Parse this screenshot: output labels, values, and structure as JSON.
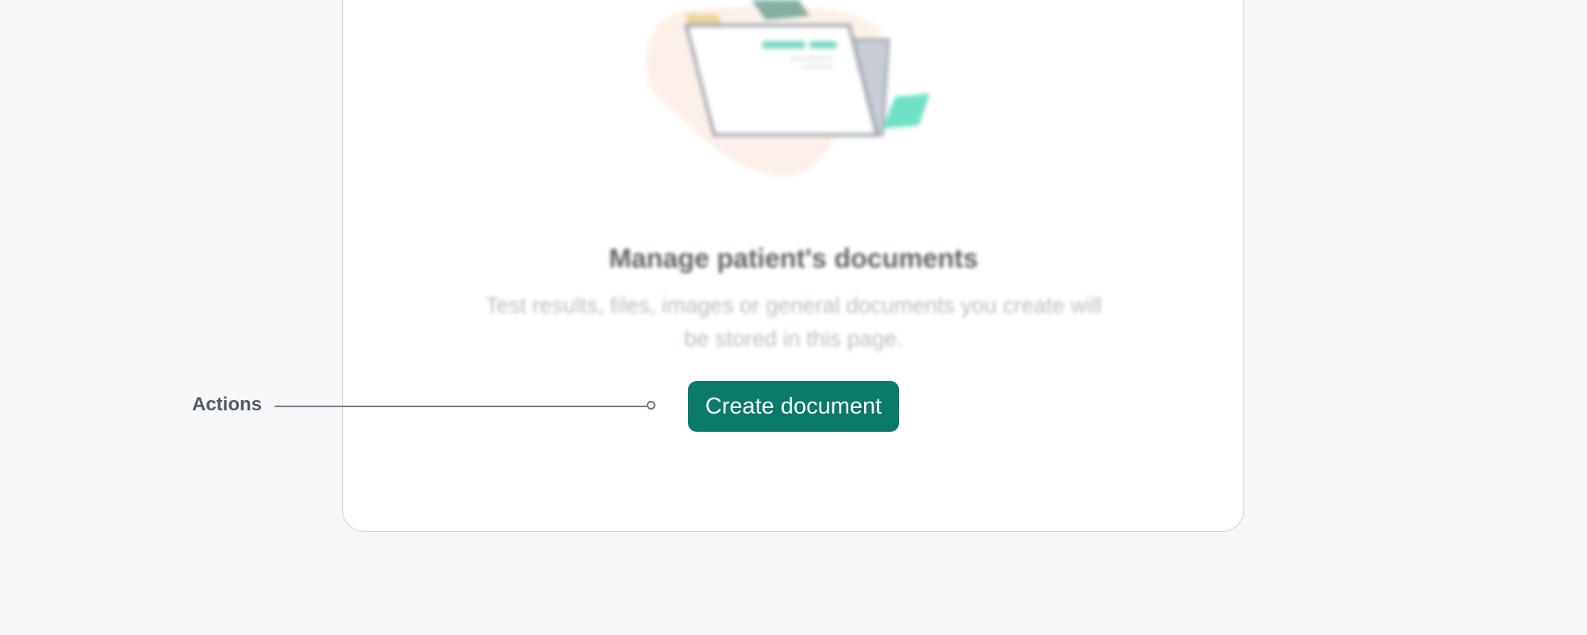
{
  "empty_state": {
    "title": "Manage patient's documents",
    "description": "Test results, files, images or general documents you create will be stored in this page.",
    "illustration_icon": "folder-icon"
  },
  "actions": {
    "create_label": "Create document"
  },
  "annotation": {
    "label": "Actions"
  },
  "colors": {
    "primary": "#0b7a68",
    "card_border": "#cfd3d8",
    "background": "#f7f8fa"
  }
}
